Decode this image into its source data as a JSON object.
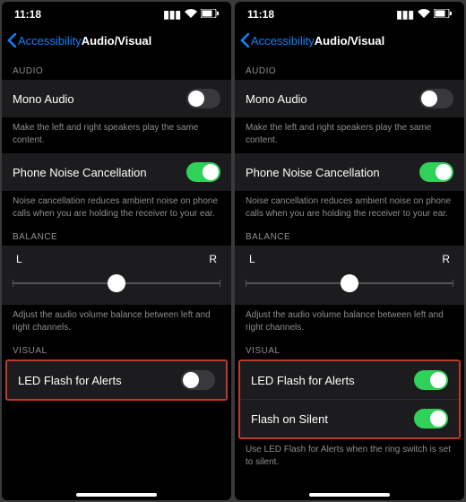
{
  "statusbar": {
    "time": "11:18"
  },
  "nav": {
    "back": "Accessibility",
    "title": "Audio/Visual"
  },
  "sections": {
    "audio_header": "AUDIO",
    "mono_audio": "Mono Audio",
    "mono_footer": "Make the left and right speakers play the same content.",
    "noise_cancel": "Phone Noise Cancellation",
    "noise_footer": "Noise cancellation reduces ambient noise on phone calls when you are holding the receiver to your ear.",
    "balance_header": "BALANCE",
    "balance_left": "L",
    "balance_right": "R",
    "balance_footer": "Adjust the audio volume balance between left and right channels.",
    "visual_header": "VISUAL",
    "led_flash": "LED Flash for Alerts",
    "flash_silent": "Flash on Silent",
    "flash_footer": "Use LED Flash for Alerts when the ring switch is set to silent."
  }
}
